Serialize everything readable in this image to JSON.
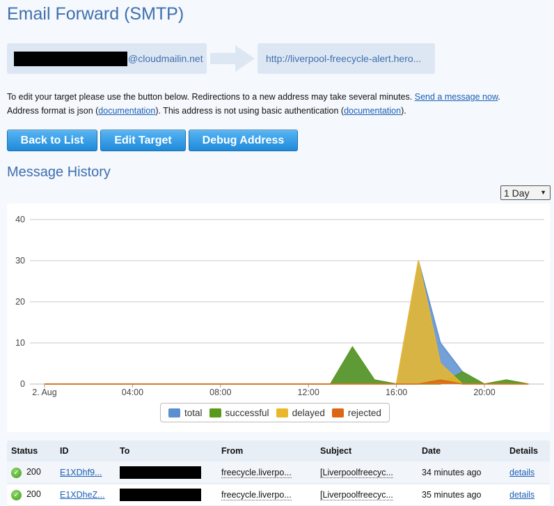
{
  "page": {
    "title": "Email Forward (SMTP)"
  },
  "address": {
    "source_domain": "@cloudmailin.net",
    "target": "http://liverpool-freecycle-alert.hero..."
  },
  "help": {
    "line1_text": "To edit your target please use the button below. Redirections to a new address may take several minutes. ",
    "line1_link": "Send a message now",
    "line1_end": ".",
    "line2_text": "Address format is json (",
    "line2_link1": "documentation",
    "line2_mid": "). This address is not using basic authentication (",
    "line2_link2": "documentation",
    "line2_end": ")."
  },
  "buttons": {
    "back": "Back to List",
    "edit": "Edit Target",
    "debug": "Debug Address"
  },
  "history": {
    "title": "Message History",
    "range": "1 Day"
  },
  "colors": {
    "total": "#5b8fd0",
    "successful": "#5a9a1a",
    "delayed": "#eab72c",
    "rejected": "#dd6614"
  },
  "chart_data": {
    "type": "area",
    "x_ticks": [
      "2. Aug",
      "04:00",
      "08:00",
      "12:00",
      "16:00",
      "20:00"
    ],
    "hours": [
      0,
      1,
      2,
      3,
      4,
      5,
      6,
      7,
      8,
      9,
      10,
      11,
      12,
      13,
      14,
      15,
      16,
      17,
      18,
      19,
      20,
      21,
      22
    ],
    "series": [
      {
        "name": "total",
        "values": [
          0,
          0,
          0,
          0,
          0,
          0,
          0,
          0,
          0,
          0,
          0,
          0,
          0,
          0,
          9,
          1,
          0,
          30,
          10,
          3,
          0,
          1,
          0
        ]
      },
      {
        "name": "successful",
        "values": [
          0,
          0,
          0,
          0,
          0,
          0,
          0,
          0,
          0,
          0,
          0,
          0,
          0,
          0,
          9,
          1,
          0,
          0,
          0,
          3,
          0,
          1,
          0
        ]
      },
      {
        "name": "delayed",
        "values": [
          0,
          0,
          0,
          0,
          0,
          0,
          0,
          0,
          0,
          0,
          0,
          0,
          0,
          0,
          0,
          0,
          0,
          30,
          5,
          0,
          0,
          0,
          0
        ]
      },
      {
        "name": "rejected",
        "values": [
          0,
          0,
          0,
          0,
          0,
          0,
          0,
          0,
          0,
          0,
          0,
          0,
          0,
          0,
          0,
          0,
          0,
          0,
          1,
          0,
          0,
          0,
          0
        ]
      }
    ],
    "ylim": [
      0,
      40
    ],
    "y_ticks": [
      0,
      10,
      20,
      30,
      40
    ],
    "grid": true,
    "legend": "bottom"
  },
  "table": {
    "headers": [
      "Status",
      "ID",
      "To",
      "From",
      "Subject",
      "Date",
      "Details"
    ],
    "rows": [
      {
        "code": "200",
        "id": "E1XDhf9...",
        "from": "freecycle.liverpo...",
        "subject": "[Liverpoolfreecyc...",
        "date": "34 minutes ago",
        "details": "details"
      },
      {
        "code": "200",
        "id": "E1XDheZ...",
        "from": "freecycle.liverpo...",
        "subject": "[Liverpoolfreecyc...",
        "date": "35 minutes ago",
        "details": "details"
      }
    ]
  }
}
